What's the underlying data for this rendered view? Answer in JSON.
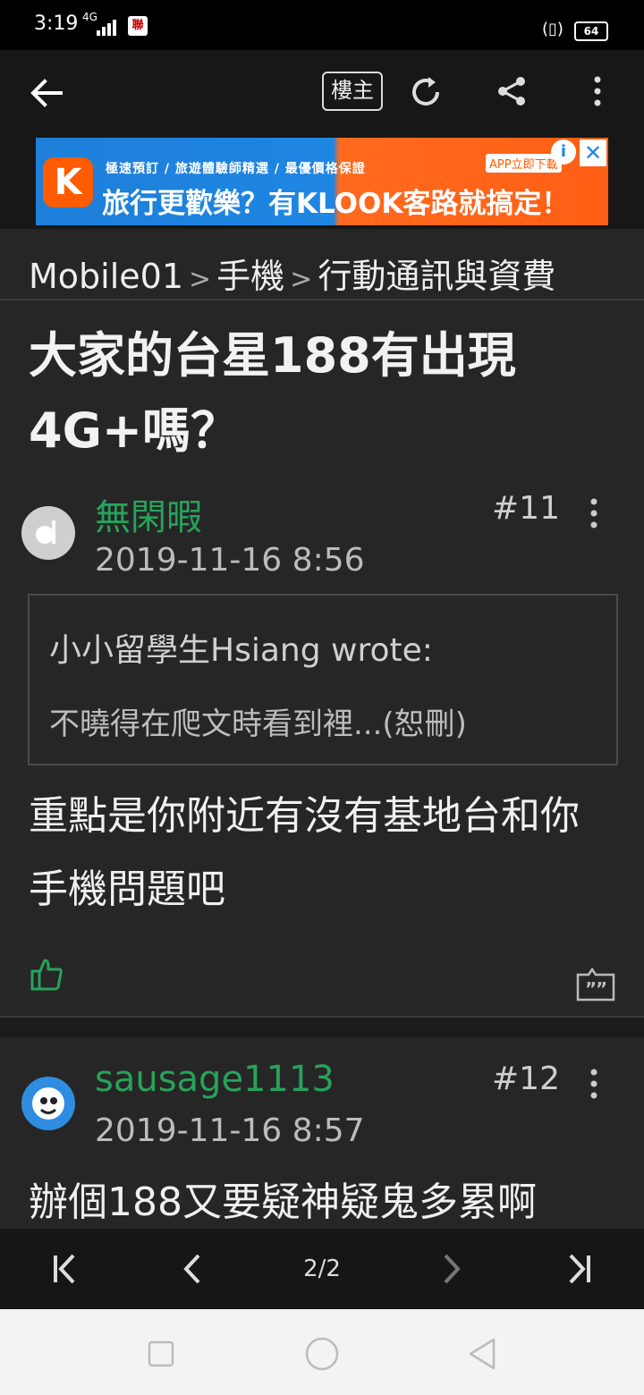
{
  "status_bar": {
    "time": "3:19",
    "network": "4G",
    "notification_badge": "聯",
    "battery": "64"
  },
  "toolbar": {
    "op_label": "樓主"
  },
  "ad": {
    "small_text": "極速預訂 / 旅遊體驗師精選 / 最優價格保證",
    "big_text": "旅行更歡樂？有KLOOK客路就搞定！",
    "app_label": "APP立即下載",
    "logo_letter": "K",
    "info": "i",
    "close": "✕"
  },
  "breadcrumb": {
    "items": [
      "Mobile01",
      "手機",
      "行動通訊與資費"
    ],
    "separator": ">"
  },
  "thread": {
    "title": "大家的台星188有出現4G+嗎？"
  },
  "posts": [
    {
      "username": "無閑暇",
      "date": "2019-11-16 8:56",
      "floor": "#11",
      "quote": {
        "author": "小小留學生Hsiang wrote:",
        "text": "不曉得在爬文時看到裡...(恕刪)"
      },
      "body": "重點是你附近有沒有基地台和你手機問題吧"
    },
    {
      "username": "sausage1113",
      "date": "2019-11-16 8:57",
      "floor": "#12",
      "body": "辦個188又要疑神疑鬼多累啊"
    }
  ],
  "pager": {
    "page": "2/2"
  },
  "colors": {
    "background": "#262626",
    "username": "#27a35a",
    "accent_like": "#27a35a"
  }
}
